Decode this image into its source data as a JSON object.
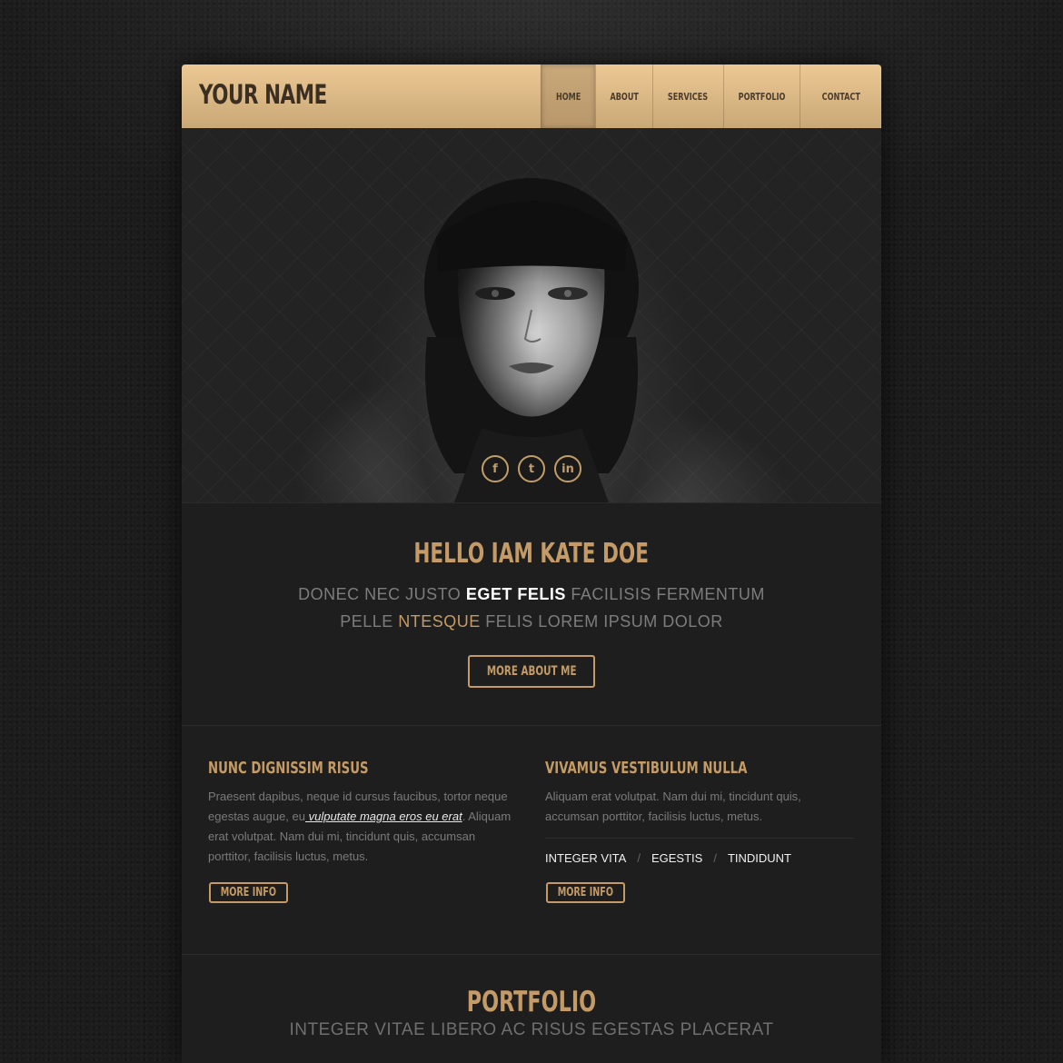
{
  "header": {
    "logo": "YOUR NAME",
    "nav": [
      "HOME",
      "ABOUT",
      "SERVICES",
      "PORTFOLIO",
      "CONTACT"
    ]
  },
  "hero": {
    "social": [
      {
        "icon": "facebook-icon",
        "glyph": "f"
      },
      {
        "icon": "twitter-icon",
        "glyph": "t"
      },
      {
        "icon": "linkedin-icon",
        "glyph": "in"
      }
    ]
  },
  "intro": {
    "title": "HELLO IAM KATE DOE",
    "line1_a": "DONEC NEC JUSTO ",
    "line1_b": "EGET FELIS",
    "line1_c": " FACILISIS FERMENTUM",
    "line2_a": "PELLE ",
    "line2_b": "NTESQUE",
    "line2_c": " FELIS LOREM IPSUM DOLOR",
    "button": "MORE ABOUT ME"
  },
  "columns": {
    "left": {
      "title": "NUNC DIGNISSIM RISUS",
      "text_a": "Praesent dapibus, neque id cursus faucibus, tortor neque egestas augue, eu",
      "link": " vulputate magna eros eu erat",
      "text_b": ". Aliquam erat volutpat. Nam dui mi, tincidunt quis, accumsan porttitor, facilisis luctus, metus.",
      "button": "MORE INFO"
    },
    "right": {
      "title": "VIVAMUS VESTIBULUM NULLA",
      "text": "Aliquam erat volutpat. Nam dui mi, tincidunt quis, accumsan porttitor, facilisis luctus, metus.",
      "tags": [
        "INTEGER VITA",
        "EGESTIS",
        "TINDIDUNT"
      ],
      "separator": "/",
      "button": "MORE INFO"
    }
  },
  "portfolio": {
    "title": "PORTFOLIO",
    "subtitle": "INTEGER VITAE LIBERO AC RISUS EGESTAS PLACERAT"
  },
  "colors": {
    "accent": "#c49b66",
    "header_top": "#ecc893",
    "header_bottom": "#c9a877",
    "panel": "#1e1e1e"
  }
}
